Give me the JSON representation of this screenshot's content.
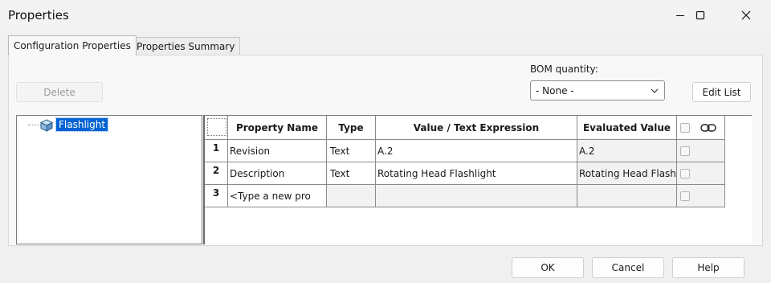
{
  "window": {
    "title": "Properties"
  },
  "tabs": [
    {
      "label": "Configuration Properties",
      "active": true
    },
    {
      "label": "Properties Summary",
      "active": false
    }
  ],
  "toolbar": {
    "delete_label": "Delete",
    "bom_quantity_label": "BOM quantity:",
    "bom_quantity_value": "- None -",
    "edit_list_label": "Edit List"
  },
  "tree": {
    "items": [
      {
        "label": "Flashlight",
        "icon": "part-cube-icon",
        "selected": true
      }
    ]
  },
  "grid": {
    "columns": [
      "Property Name",
      "Type",
      "Value / Text Expression",
      "Evaluated Value"
    ],
    "rows": [
      {
        "num": "1",
        "name": "Revision",
        "type": "Text",
        "value": "A.2",
        "evaluated": "A.2"
      },
      {
        "num": "2",
        "name": "Description",
        "type": "Text",
        "value": "Rotating Head Flashlight",
        "evaluated": "Rotating Head Flashli"
      },
      {
        "num": "3",
        "name": "<Type a new pro",
        "type": "",
        "value": "",
        "evaluated": ""
      }
    ]
  },
  "footer": {
    "ok_label": "OK",
    "cancel_label": "Cancel",
    "help_label": "Help"
  },
  "colors": {
    "selection": "#0063d1",
    "evaluated_bg": "#f2f2f2"
  }
}
